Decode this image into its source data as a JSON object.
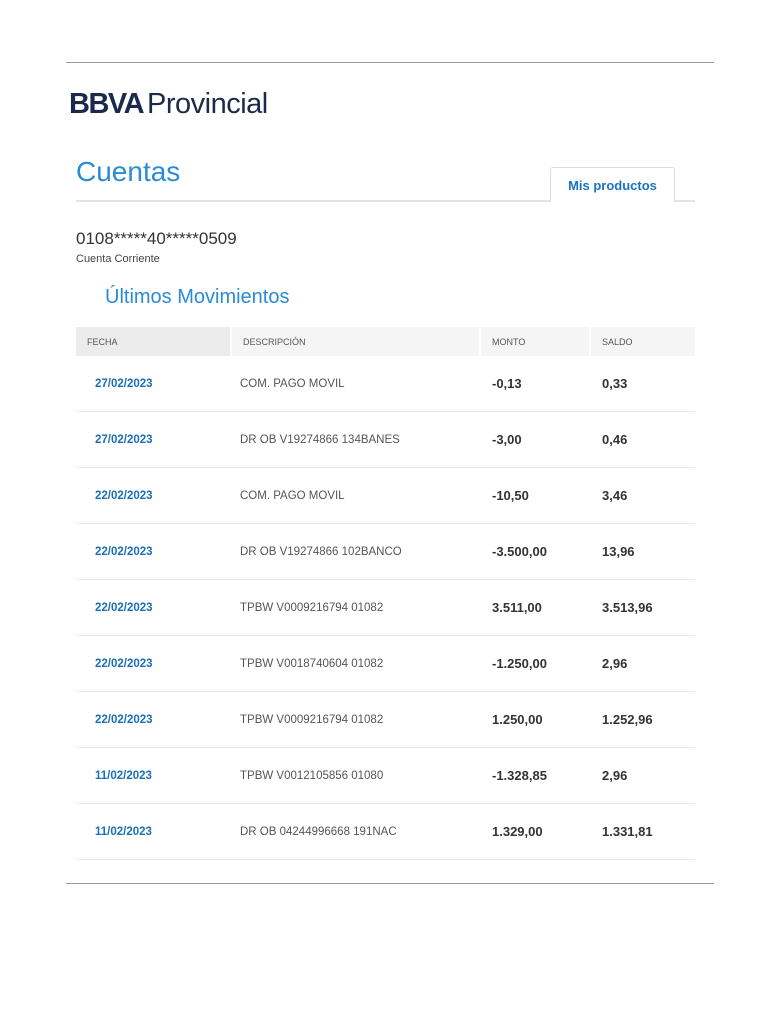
{
  "brand": {
    "bold": "BBVA",
    "light": "Provincial"
  },
  "page_title": "Cuentas",
  "tab_label": "Mis productos",
  "account": {
    "number": "0108*****40*****0509",
    "type": "Cuenta Corriente"
  },
  "section_title": "Últimos Movimientos",
  "table": {
    "headers": [
      "FECHA",
      "DESCRIPCIÓN",
      "MONTO",
      "SALDO"
    ],
    "rows": [
      {
        "fecha": "27/02/2023",
        "descripcion": "COM. PAGO MOVIL",
        "monto": "-0,13",
        "saldo": "0,33"
      },
      {
        "fecha": "27/02/2023",
        "descripcion": "DR OB V19274866 134BANES",
        "monto": "-3,00",
        "saldo": "0,46"
      },
      {
        "fecha": "22/02/2023",
        "descripcion": "COM. PAGO MOVIL",
        "monto": "-10,50",
        "saldo": "3,46"
      },
      {
        "fecha": "22/02/2023",
        "descripcion": "DR OB V19274866 102BANCO",
        "monto": "-3.500,00",
        "saldo": "13,96"
      },
      {
        "fecha": "22/02/2023",
        "descripcion": "TPBW V0009216794 01082",
        "monto": "3.511,00",
        "saldo": "3.513,96"
      },
      {
        "fecha": "22/02/2023",
        "descripcion": "TPBW V0018740604 01082",
        "monto": "-1.250,00",
        "saldo": "2,96"
      },
      {
        "fecha": "22/02/2023",
        "descripcion": "TPBW V0009216794 01082",
        "monto": "1.250,00",
        "saldo": "1.252,96"
      },
      {
        "fecha": "11/02/2023",
        "descripcion": "TPBW V0012105856 01080",
        "monto": "-1.328,85",
        "saldo": "2,96"
      },
      {
        "fecha": "11/02/2023",
        "descripcion": "DR OB 04244996668 191NAC",
        "monto": "1.329,00",
        "saldo": "1.331,81"
      }
    ]
  }
}
